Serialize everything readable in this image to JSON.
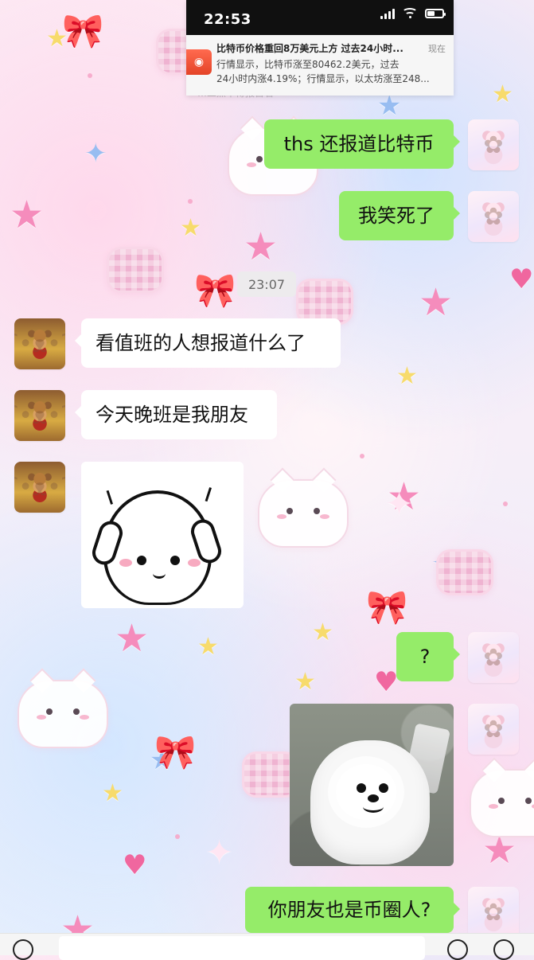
{
  "status_bar": {
    "time": "22:53"
  },
  "notification": {
    "app_icon_label": "◉",
    "title": "比特币价格重回8万美元上方 过去24小时...",
    "time": "现在",
    "line1": "行情显示，比特币涨至80462.2美元，过去",
    "line2": "24小时内涨4.19%；行情显示，以太坊涨至248..."
  },
  "partially_hidden_text": "…二点半得报百名",
  "chat": {
    "timestamp": "23:07",
    "messages": [
      {
        "text": "ths 还报道比特币"
      },
      {
        "text": "我笑死了"
      },
      {
        "text": "看值班的人想报道什么了"
      },
      {
        "text": "今天晚班是我朋友"
      },
      {
        "text": "?"
      },
      {
        "text": "你朋友也是币圈人?"
      }
    ]
  },
  "colors": {
    "incoming_bubble": "#ffffff",
    "outgoing_bubble": "#95ec69",
    "notification_bg": "#eeeeee",
    "app_icon": "#e44428"
  },
  "icons": {
    "signal": "signal-icon",
    "wifi": "wifi-icon",
    "battery": "battery-icon",
    "app": "news-app-icon",
    "voice": "voice-icon",
    "emoji": "emoji-icon",
    "plus": "plus-icon"
  }
}
